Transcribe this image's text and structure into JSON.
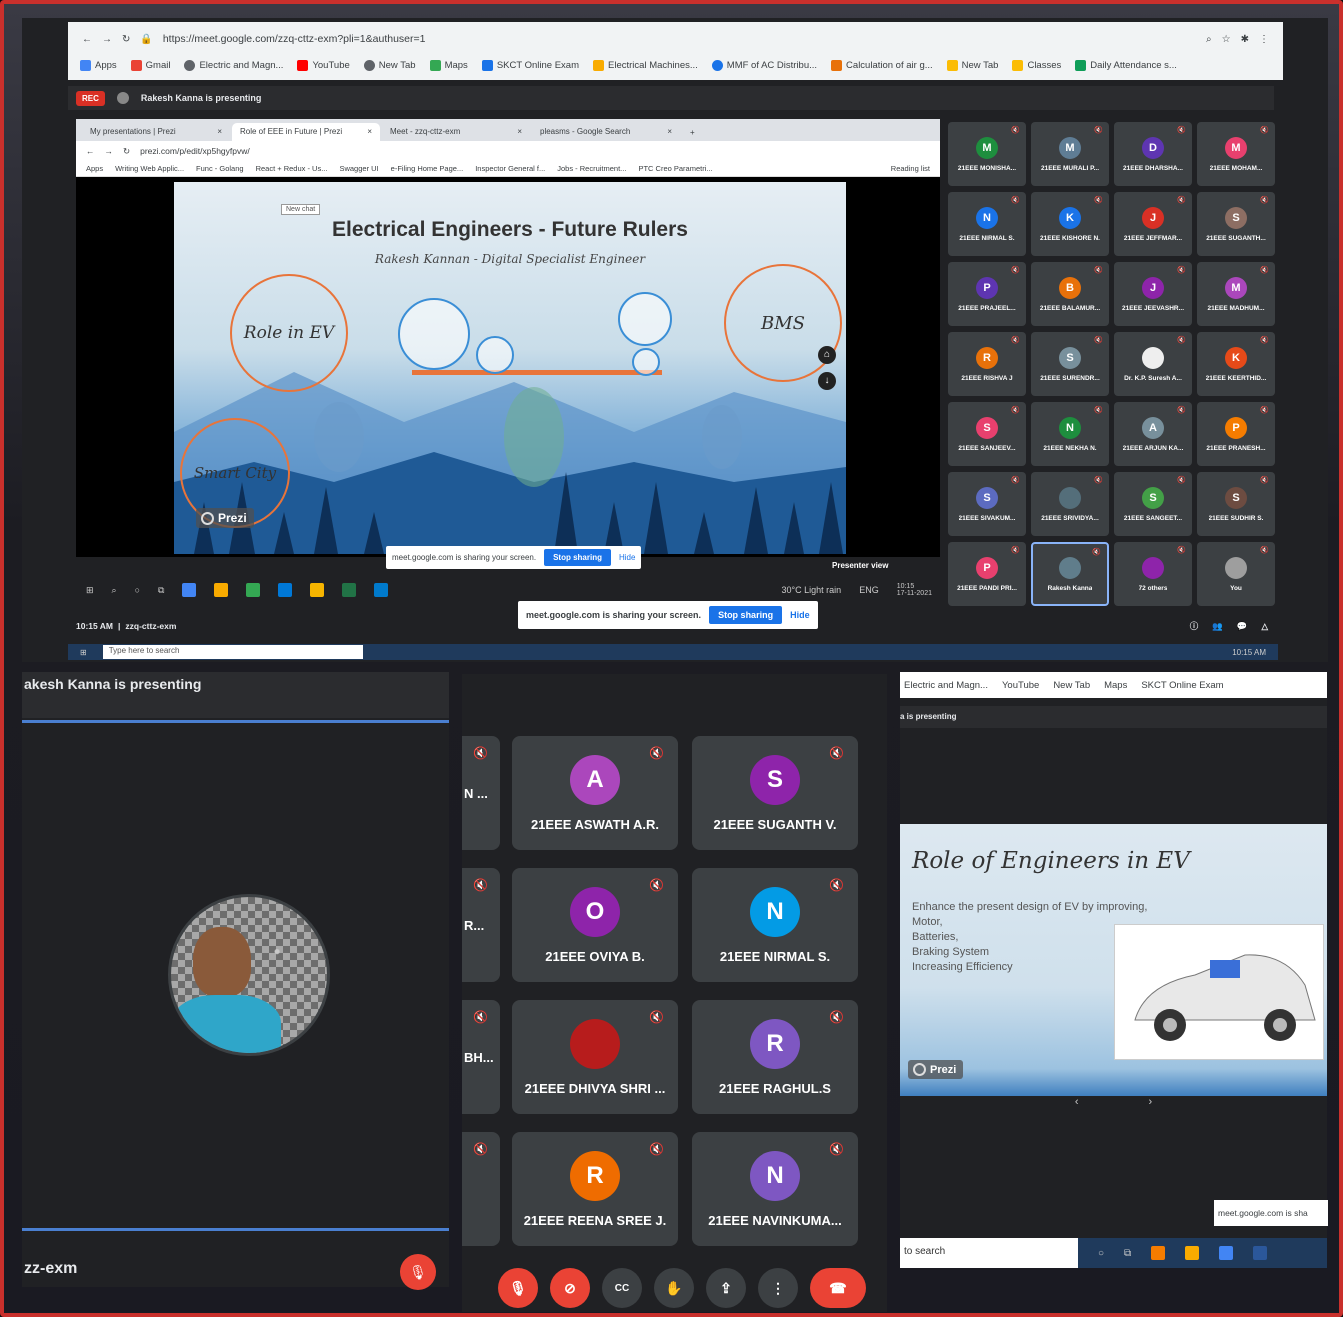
{
  "browser": {
    "url": "https://meet.google.com/zzq-cttz-exm?pli=1&authuser=1",
    "bookmarks": [
      "Apps",
      "Gmail",
      "Electric and Magn...",
      "YouTube",
      "New Tab",
      "Maps",
      "SKCT Online Exam",
      "Electrical Machines...",
      "MMF of AC Distribu...",
      "Calculation of air g...",
      "New Tab",
      "Classes",
      "Daily Attendance s..."
    ]
  },
  "meet_bar": {
    "rec": "REC",
    "presenting": "Rakesh Kanna is presenting"
  },
  "shared": {
    "tabs": [
      "My presentations | Prezi",
      "Role of EEE in Future | Prezi",
      "Meet - zzq-cttz-exm",
      "pleasms - Google Search"
    ],
    "url": "prezi.com/p/edit/xp5hgyfpvw/",
    "bookmarks": [
      "Apps",
      "Writing Web Applic...",
      "Func - Golang",
      "React + Redux - Us...",
      "Swagger UI",
      "e-Filing Home Page...",
      "Inspector General f...",
      "Jobs - Recruitment...",
      "PTC Creo Parametri...",
      "Reading list"
    ],
    "slide": {
      "new_chat": "New chat",
      "title": "Electrical Engineers - Future Rulers",
      "subtitle": "Rakesh Kannan - Digital Specialist Engineer",
      "topic1": "Role in EV",
      "topic2": "BMS",
      "topic3": "Smart City",
      "brand": "Prezi"
    },
    "share_popup": {
      "text": "meet.google.com is sharing your screen.",
      "stop": "Stop sharing",
      "hide": "Hide"
    },
    "presenter_view": "Presenter view",
    "weather": "30°C Light rain",
    "lang": "ENG",
    "time": "10:15",
    "date": "17-11-2021"
  },
  "participants_grid": [
    {
      "initial": "M",
      "name": "21EEE MONISHA...",
      "color": "#1e8e3e"
    },
    {
      "initial": "M",
      "name": "21EEE MURALI P...",
      "color": "#5f7d95"
    },
    {
      "initial": "D",
      "name": "21EEE DHARSHA...",
      "color": "#5e35b1"
    },
    {
      "initial": "M",
      "name": "21EEE MOHAM...",
      "color": "#e8406e"
    },
    {
      "initial": "N",
      "name": "21EEE NIRMAL S.",
      "color": "#1a73e8"
    },
    {
      "initial": "K",
      "name": "21EEE KISHORE N.",
      "color": "#1a73e8"
    },
    {
      "initial": "J",
      "name": "21EEE JEFFMAR...",
      "color": "#d93025"
    },
    {
      "initial": "S",
      "name": "21EEE SUGANTH...",
      "color": "#8d6e63"
    },
    {
      "initial": "P",
      "name": "21EEE PRAJEEL...",
      "color": "#5e35b1"
    },
    {
      "initial": "B",
      "name": "21EEE BALAMUR...",
      "color": "#e8710a"
    },
    {
      "initial": "J",
      "name": "21EEE JEEVASHR...",
      "color": "#8e24aa"
    },
    {
      "initial": "M",
      "name": "21EEE MADHUM...",
      "color": "#ab47bc"
    },
    {
      "initial": "R",
      "name": "21EEE RISHVA J",
      "color": "#e8710a"
    },
    {
      "initial": "S",
      "name": "21EEE SURENDR...",
      "color": "#78909c"
    },
    {
      "initial": "",
      "name": "Dr. K.P. Suresh A...",
      "color": "#eeeeee"
    },
    {
      "initial": "K",
      "name": "21EEE KEERTHID...",
      "color": "#e64a19"
    },
    {
      "initial": "S",
      "name": "21EEE SANJEEV...",
      "color": "#e8406e"
    },
    {
      "initial": "N",
      "name": "21EEE NEKHA N.",
      "color": "#1e8e3e"
    },
    {
      "initial": "A",
      "name": "21EEE ARJUN KA...",
      "color": "#78909c"
    },
    {
      "initial": "P",
      "name": "21EEE PRANESH...",
      "color": "#f57c00"
    },
    {
      "initial": "S",
      "name": "21EEE SIVAKUM...",
      "color": "#5c6bc0"
    },
    {
      "initial": "",
      "name": "21EEE SRIVIDYA...",
      "color": "#546e7a"
    },
    {
      "initial": "S",
      "name": "21EEE SANGEET...",
      "color": "#43a047"
    },
    {
      "initial": "S",
      "name": "21EEE SUDHIR S.",
      "color": "#6d4c41"
    },
    {
      "initial": "P",
      "name": "21EEE PANDI PRI...",
      "color": "#e8406e"
    },
    {
      "initial": "",
      "name": "Rakesh Kanna",
      "color": "#607d8b"
    },
    {
      "initial": "",
      "name": "72 others",
      "color": "#8e24aa"
    },
    {
      "initial": "",
      "name": "You",
      "color": "#9e9e9e"
    }
  ],
  "meet_footer": {
    "time": "10:15 AM",
    "code": "zzq-cttz-exm"
  },
  "win_taskbar": {
    "search": "Type here to search",
    "time": "10:15 AM"
  },
  "left_panel": {
    "presenting": "akesh Kanna is presenting",
    "code": "zz-exm"
  },
  "middle_panel": {
    "edge_labels": [
      "N ...",
      "R...",
      "BH..."
    ],
    "tiles": [
      {
        "initial": "A",
        "name": "21EEE ASWATH A.R.",
        "color": "#ab47bc"
      },
      {
        "initial": "S",
        "name": "21EEE SUGANTH V.",
        "color": "#8e24aa"
      },
      {
        "initial": "O",
        "name": "21EEE OVIYA B.",
        "color": "#8e24aa"
      },
      {
        "initial": "N",
        "name": "21EEE NIRMAL S.",
        "color": "#039be5"
      },
      {
        "initial": "",
        "name": "21EEE DHIVYA SHRI ...",
        "color": "#b71c1c"
      },
      {
        "initial": "R",
        "name": "21EEE RAGHUL.S",
        "color": "#7e57c2"
      },
      {
        "initial": "R",
        "name": "21EEE REENA SREE J.",
        "color": "#ef6c00"
      },
      {
        "initial": "N",
        "name": "21EEE NAVINKUMA...",
        "color": "#7e57c2"
      }
    ]
  },
  "right_panel": {
    "bookmarks": [
      "Electric and Magn...",
      "YouTube",
      "New Tab",
      "Maps",
      "SKCT Online Exam"
    ],
    "presenting": "a is presenting",
    "slide_title": "Role of Engineers in EV",
    "slide_points": [
      "Enhance the present design of EV by improving,",
      "Motor,",
      "Batteries,",
      "Braking System",
      "Increasing Efficiency"
    ],
    "brand": "Prezi",
    "toast": "meet.google.com is sha",
    "search": "to search"
  }
}
